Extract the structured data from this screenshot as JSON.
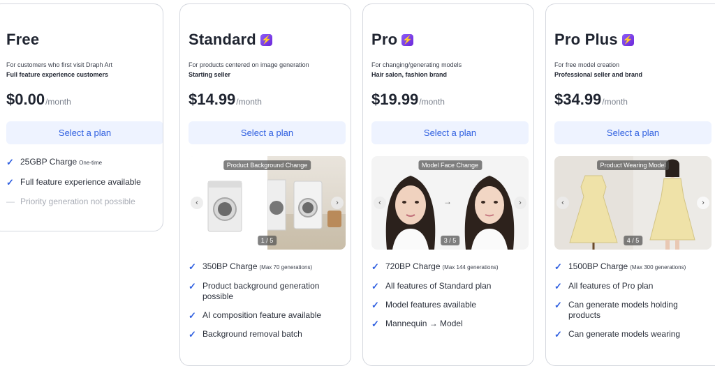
{
  "plans": [
    {
      "name": "Free",
      "description": "For customers who first visit Draph Art",
      "subtitle": "Full feature experience customers",
      "price": "$0.00",
      "period": "/month",
      "button": "Select a plan",
      "features": [
        {
          "text": "25GBP Charge",
          "note": "One-time",
          "enabled": true
        },
        {
          "text": "Full feature experience available",
          "note": "",
          "enabled": true
        },
        {
          "text": "Priority generation not possible",
          "note": "",
          "enabled": false
        }
      ]
    },
    {
      "name": "Standard",
      "description": "For products centered on image generation",
      "subtitle": "Starting seller",
      "price": "$14.99",
      "period": "/month",
      "button": "Select a plan",
      "slide_label": "Product Background Change",
      "slide_counter": "1 / 5",
      "features": [
        {
          "text": "350BP Charge",
          "note": "(Max 70 generations)"
        },
        {
          "text": "Product background generation possible",
          "note": ""
        },
        {
          "text": "AI composition feature available",
          "note": ""
        },
        {
          "text": "Background removal batch",
          "note": ""
        }
      ]
    },
    {
      "name": "Pro",
      "description": "For changing/generating models",
      "subtitle": "Hair salon, fashion brand",
      "price": "$19.99",
      "period": "/month",
      "button": "Select a plan",
      "slide_label": "Model Face Change",
      "slide_counter": "3 / 5",
      "features": [
        {
          "text": "720BP Charge",
          "note": "(Max 144 generations)"
        },
        {
          "text": "All features of Standard plan",
          "note": ""
        },
        {
          "text": "Model features available",
          "note": ""
        },
        {
          "text": "Mannequin → Model",
          "note": ""
        }
      ]
    },
    {
      "name": "Pro Plus",
      "description": "For free model creation",
      "subtitle": "Professional seller and brand",
      "price": "$34.99",
      "period": "/month",
      "button": "Select a plan",
      "slide_label": "Product Wearing Model",
      "slide_counter": "4 / 5",
      "features": [
        {
          "text": "1500BP Charge",
          "note": "(Max 300 generations)"
        },
        {
          "text": "All features of Pro plan",
          "note": ""
        },
        {
          "text": "Can generate models holding products",
          "note": ""
        },
        {
          "text": "Can generate models wearing",
          "note": ""
        }
      ]
    }
  ],
  "icons": {
    "check": "check-icon",
    "dash": "dash-icon",
    "bolt": "lightning-bolt-icon",
    "prev": "chevron-left-icon",
    "next": "chevron-right-icon"
  },
  "colors": {
    "accent": "#2f5fe0",
    "button_bg": "#eef3ff",
    "bolt_gradient_start": "#8b5cf6",
    "bolt_gradient_end": "#6d28d9",
    "disabled_text": "#a9adb6"
  }
}
